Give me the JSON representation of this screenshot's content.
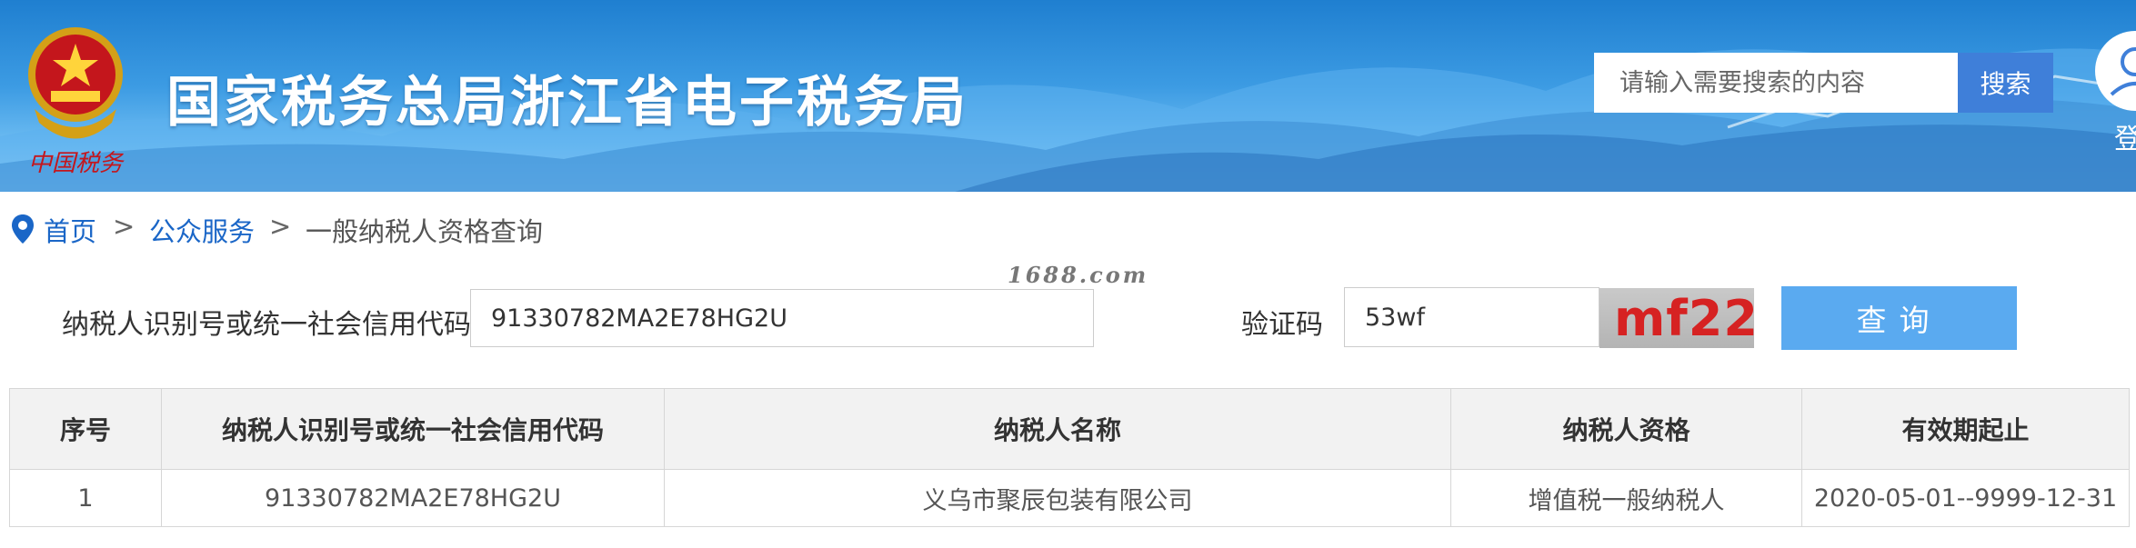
{
  "header": {
    "site_title": "国家税务总局浙江省电子税务局",
    "emblem_caption": "中国税务",
    "search_placeholder": "请输入需要搜索的内容",
    "search_button": "搜索",
    "login_label": "登"
  },
  "breadcrumb": {
    "items": [
      {
        "label": "首页"
      },
      {
        "label": "公众服务"
      },
      {
        "label": "一般纳税人资格查询"
      }
    ],
    "separator": ">"
  },
  "watermark": "1688.com",
  "query_form": {
    "taxpayer_id_label": "纳税人识别号或统一社会信用代码",
    "taxpayer_id_value": "91330782MA2E78HG2U",
    "captcha_label": "验证码",
    "captcha_value": "53wf",
    "captcha_image_text": "mf22",
    "query_button": "查询"
  },
  "results_table": {
    "headers": [
      "序号",
      "纳税人识别号或统一社会信用代码",
      "纳税人名称",
      "纳税人资格",
      "有效期起止"
    ],
    "rows": [
      [
        "1",
        "91330782MA2E78HG2U",
        "义乌市聚辰包装有限公司",
        "增值税一般纳税人",
        "2020-05-01--9999-12-31"
      ]
    ]
  },
  "colors": {
    "banner_blue": "#2f8fdc",
    "search_button": "#3f7fd9",
    "query_button": "#5aaaf0",
    "link": "#1a66c7",
    "captcha_text": "#d62222"
  }
}
